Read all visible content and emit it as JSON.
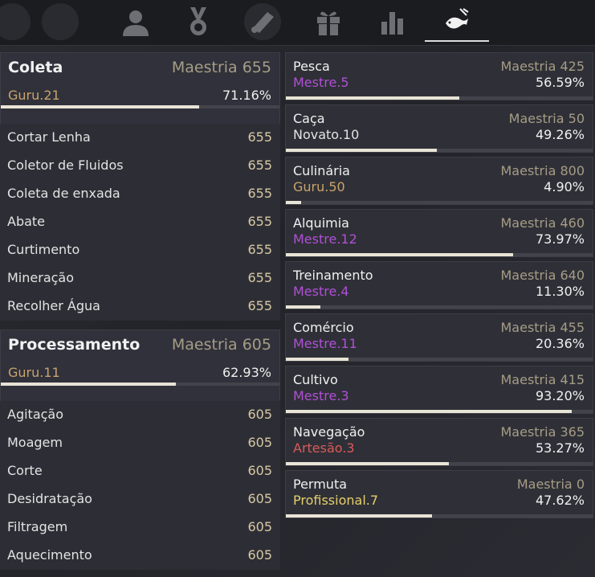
{
  "tabs": [
    {
      "icon": "profile-icon"
    },
    {
      "icon": "medal-icon"
    },
    {
      "icon": "scroll-icon"
    },
    {
      "icon": "gift-icon"
    },
    {
      "icon": "bar-chart-icon"
    },
    {
      "icon": "fishing-icon",
      "active": true
    }
  ],
  "groups": [
    {
      "title": "Coleta",
      "mastery": "Maestria 655",
      "rank": "Guru.21",
      "pct": "71.16%",
      "progress": 0.7116,
      "skills": [
        {
          "name": "Cortar Lenha",
          "value": "655"
        },
        {
          "name": "Coletor de Fluidos",
          "value": "655"
        },
        {
          "name": "Coleta de enxada",
          "value": "655"
        },
        {
          "name": "Abate",
          "value": "655"
        },
        {
          "name": "Curtimento",
          "value": "655"
        },
        {
          "name": "Mineração",
          "value": "655"
        },
        {
          "name": "Recolher Água",
          "value": "655"
        }
      ]
    },
    {
      "title": "Processamento",
      "mastery": "Maestria 605",
      "rank": "Guru.11",
      "pct": "62.93%",
      "progress": 0.6293,
      "skills": [
        {
          "name": "Agitação",
          "value": "605"
        },
        {
          "name": "Moagem",
          "value": "605"
        },
        {
          "name": "Corte",
          "value": "605"
        },
        {
          "name": "Desidratação",
          "value": "605"
        },
        {
          "name": "Filtragem",
          "value": "605"
        },
        {
          "name": "Aquecimento",
          "value": "605"
        }
      ]
    }
  ],
  "lifeskills": [
    {
      "name": "Pesca",
      "mastery": "Maestria 425",
      "rank": "Mestre.5",
      "pct": "56.59%",
      "progress": 0.5659,
      "rank_color": "#b04fd6"
    },
    {
      "name": "Caça",
      "mastery": "Maestria 50",
      "rank": "Novato.10",
      "pct": "49.26%",
      "progress": 0.4926,
      "rank_color": "#e3e3e3"
    },
    {
      "name": "Culinária",
      "mastery": "Maestria 800",
      "rank": "Guru.50",
      "pct": "4.90%",
      "progress": 0.049,
      "rank_color": "#c9a36b"
    },
    {
      "name": "Alquimia",
      "mastery": "Maestria 460",
      "rank": "Mestre.12",
      "pct": "73.97%",
      "progress": 0.7397,
      "rank_color": "#b04fd6"
    },
    {
      "name": "Treinamento",
      "mastery": "Maestria 640",
      "rank": "Mestre.4",
      "pct": "11.30%",
      "progress": 0.113,
      "rank_color": "#b04fd6"
    },
    {
      "name": "Comércio",
      "mastery": "Maestria 455",
      "rank": "Mestre.11",
      "pct": "20.36%",
      "progress": 0.2036,
      "rank_color": "#b04fd6"
    },
    {
      "name": "Cultivo",
      "mastery": "Maestria 415",
      "rank": "Mestre.3",
      "pct": "93.20%",
      "progress": 0.932,
      "rank_color": "#b04fd6"
    },
    {
      "name": "Navegação",
      "mastery": "Maestria 365",
      "rank": "Artesão.3",
      "pct": "53.27%",
      "progress": 0.5327,
      "rank_color": "#d85a5a"
    },
    {
      "name": "Permuta",
      "mastery": "Maestria 0",
      "rank": "Profissional.7",
      "pct": "47.62%",
      "progress": 0.4762,
      "rank_color": "#e6cf6a"
    }
  ]
}
